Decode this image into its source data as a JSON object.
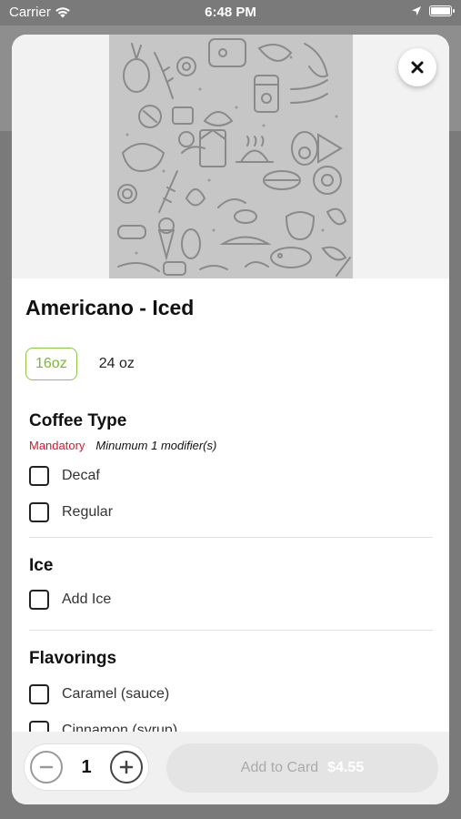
{
  "status_bar": {
    "carrier": "Carrier",
    "time": "6:48 PM",
    "wifi_icon": "wifi-icon",
    "location_icon": "location-arrow-icon",
    "battery_icon": "battery-full-icon"
  },
  "close_icon": "close-icon",
  "product": {
    "title": "Americano - Iced",
    "sizes": [
      {
        "label": "16oz",
        "selected": true
      },
      {
        "label": "24 oz",
        "selected": false
      }
    ]
  },
  "modifier_groups": [
    {
      "title": "Coffee Type",
      "mandatory": "Mandatory",
      "note": "Minumum 1 modifier(s)",
      "options": [
        "Decaf",
        "Regular"
      ]
    },
    {
      "title": "Ice",
      "options": [
        "Add Ice"
      ]
    },
    {
      "title": "Flavorings",
      "options": [
        "Caramel (sauce)",
        "Cinnamon (syrup)"
      ]
    }
  ],
  "footer": {
    "quantity": "1",
    "minus_icon": "minus-icon",
    "plus_icon": "plus-icon",
    "add_label": "Add to Card",
    "price": "$4.55"
  },
  "colors": {
    "accent_green": "#8dc63f",
    "mandatory_red": "#e0142c"
  }
}
